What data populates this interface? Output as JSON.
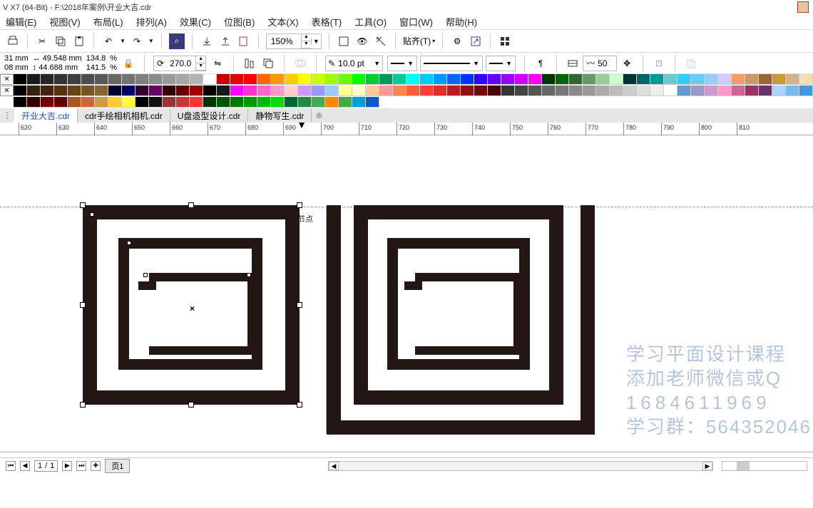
{
  "title": "V X7 (64-Bit) - F:\\2018年案例\\开业大吉.cdr",
  "menu": [
    "编辑(E)",
    "视图(V)",
    "布局(L)",
    "排列(A)",
    "效果(C)",
    "位图(B)",
    "文本(X)",
    "表格(T)",
    "工具(O)",
    "窗口(W)",
    "帮助(H)"
  ],
  "toolbar": {
    "zoom": "150%",
    "snap_label": "贴齐(T)"
  },
  "prop": {
    "x": "31 mm",
    "y": "08 mm",
    "w_icon": "↔",
    "h_icon": "↕",
    "w": "49.548 mm",
    "h": "44.688 mm",
    "sx": "134.8",
    "sy": "141.5",
    "pct": "%",
    "angle": "270.0",
    "outline_width": "10.0 pt",
    "contour_steps": "50"
  },
  "palette_row1": [
    "#000000",
    "#1a1a1a",
    "#262626",
    "#333333",
    "#404040",
    "#4d4d4d",
    "#595959",
    "#666666",
    "#737373",
    "#808080",
    "#8c8c8c",
    "#999999",
    "#a6a6a6",
    "#b3b3b3",
    "#ffffff",
    "#cc0000",
    "#e60000",
    "#ff0000",
    "#ff6600",
    "#ff9900",
    "#ffcc00",
    "#ffff00",
    "#ccff00",
    "#99ff00",
    "#66ff00",
    "#00ff00",
    "#00cc33",
    "#009966",
    "#00cc99",
    "#00ffff",
    "#00ccff",
    "#0099ff",
    "#0066ff",
    "#0033ff",
    "#3300ff",
    "#6600ff",
    "#9900ff",
    "#cc00ff",
    "#ff00ff",
    "#003300",
    "#006600",
    "#336633",
    "#669966",
    "#99cc99",
    "#ccffcc",
    "#003333",
    "#006666",
    "#009999",
    "#66cccc",
    "#33ccff",
    "#66ccff",
    "#99ccff",
    "#ccccff",
    "#ff9966",
    "#cc9966",
    "#996633",
    "#cc9933",
    "#d2b48c",
    "#f5deb3"
  ],
  "palette_row2": [
    "#000000",
    "#332211",
    "#442211",
    "#553311",
    "#664411",
    "#775522",
    "#886633",
    "#000033",
    "#000066",
    "#330033",
    "#660066",
    "#330000",
    "#660000",
    "#990000",
    "#000000",
    "#1a1a1a",
    "#ff00ff",
    "#ff33cc",
    "#ff66cc",
    "#ff99cc",
    "#ffcccc",
    "#cc99ff",
    "#9999ff",
    "#99ccff",
    "#ffff99",
    "#ffffcc",
    "#ffcc99",
    "#ff9999",
    "#ff854d",
    "#ff5e3a",
    "#fc3d39",
    "#e22b2b",
    "#b81d1d",
    "#8e1111",
    "#6b0a0a",
    "#4a0505",
    "#333333",
    "#444444",
    "#555555",
    "#666666",
    "#777777",
    "#888888",
    "#999999",
    "#aaaaaa",
    "#bbbbbb",
    "#cccccc",
    "#dddddd",
    "#eeeeee",
    "#ffffff",
    "#6699cc",
    "#9999cc",
    "#cc99cc",
    "#ff99cc",
    "#cc6699",
    "#993366",
    "#663366",
    "#aad4ff",
    "#77bbee",
    "#4499dd"
  ],
  "palette_row3": [
    "#000000",
    "#330000",
    "#770000",
    "#660000",
    "#aa5522",
    "#cc6633",
    "#cc9944",
    "#ffcc30",
    "#ffff33",
    "#000000",
    "#111111",
    "#993333",
    "#cc3333",
    "#ff3333",
    "#003300",
    "#005500",
    "#007700",
    "#009900",
    "#00bb00",
    "#00dd00",
    "#006633",
    "#228844",
    "#44aa55",
    "#ff8800",
    "#44aa44",
    "#009edb",
    "#1155cc"
  ],
  "tabs": [
    "开业大吉.cdr",
    "cdr手绘相机相机.cdr",
    "U盘造型设计.cdr",
    "静物写生.cdr"
  ],
  "active_tab": 0,
  "ruler_ticks": [
    620,
    630,
    640,
    650,
    660,
    670,
    680,
    690,
    700,
    710,
    720,
    730,
    740,
    750,
    760,
    770,
    780,
    790,
    800,
    810
  ],
  "node_label": "节点",
  "watermark": {
    "l1": "学习平面设计课程",
    "l2": "添加老师微信或Q",
    "l3": "1684611969",
    "l4": "学习群：564352046"
  },
  "status": {
    "page_current": "1",
    "page_sep": "/",
    "page_total": "1",
    "page_tab": "页1"
  }
}
